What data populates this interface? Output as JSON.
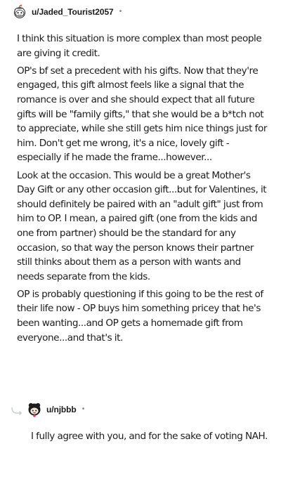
{
  "comments": [
    {
      "username": "u/Jaded_Tourist2057",
      "separator": "•",
      "avatar_icon": "snoo-avatar-icon",
      "paragraphs": [
        "I think this situation is more complex than most people are giving it credit.",
        "OP's bf set a precedent with his gifts. Now that they're engaged, this gift almost feels like a signal that the romance is over and she should expect that all future gifts will be \"family gifts,\" that she would be a b*tch not to appreciate, while she still gets him nice things just for him. Don't get me wrong, it's a nice, lovely gift - especially if he made the frame...however...",
        "Look at the occasion. This would be a great Mother's Day Gift or any other occasion gift...but for Valentines, it should definitely be paired with an \"adult gift\" just from him to OP. I mean, a paired gift (one from the kids and one from partner) should be the standard for any occasion, so that way the person knows their partner still thinks about them as a person with wants and needs separate from the kids.",
        "OP is probably questioning if this going to be the rest of their life now - OP buys him something pricey that he's been wanting...and OP gets a homemade gift from everyone...and that's it."
      ]
    },
    {
      "username": "u/njbbb",
      "separator": "•",
      "avatar_icon": "snoo-avatar-icon",
      "reply_icon": "reply-arrow-icon",
      "paragraphs": [
        "I fully agree with you, and for the sake of voting NAH."
      ]
    }
  ]
}
